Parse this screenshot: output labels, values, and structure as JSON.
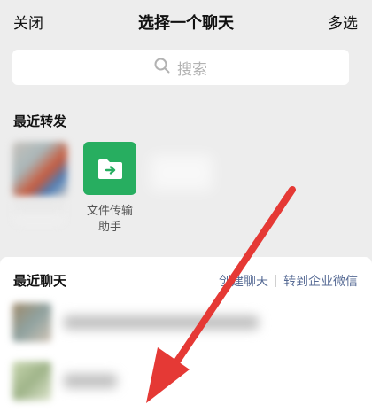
{
  "header": {
    "close_label": "关闭",
    "title": "选择一个聊天",
    "multi_select_label": "多选"
  },
  "search": {
    "placeholder": "搜索",
    "icon": "search-icon"
  },
  "recent_forwards": {
    "title": "最近转发",
    "items": [
      {
        "label": "",
        "icon": "blurred-avatar"
      },
      {
        "label": "文件传输\n助手",
        "icon": "folder-arrow-icon",
        "color": "#27ae60"
      }
    ]
  },
  "recent_chats": {
    "title": "最近聊天",
    "create_chat": "创建聊天",
    "forward_to_work": "转到企业微信",
    "rows": [
      {
        "name": "",
        "icon": "blurred-avatar"
      },
      {
        "name": "",
        "icon": "blurred-avatar"
      }
    ]
  },
  "colors": {
    "background": "#ededed",
    "link": "#576b95",
    "file_helper": "#27ae60",
    "annotation_arrow": "#e53935"
  }
}
